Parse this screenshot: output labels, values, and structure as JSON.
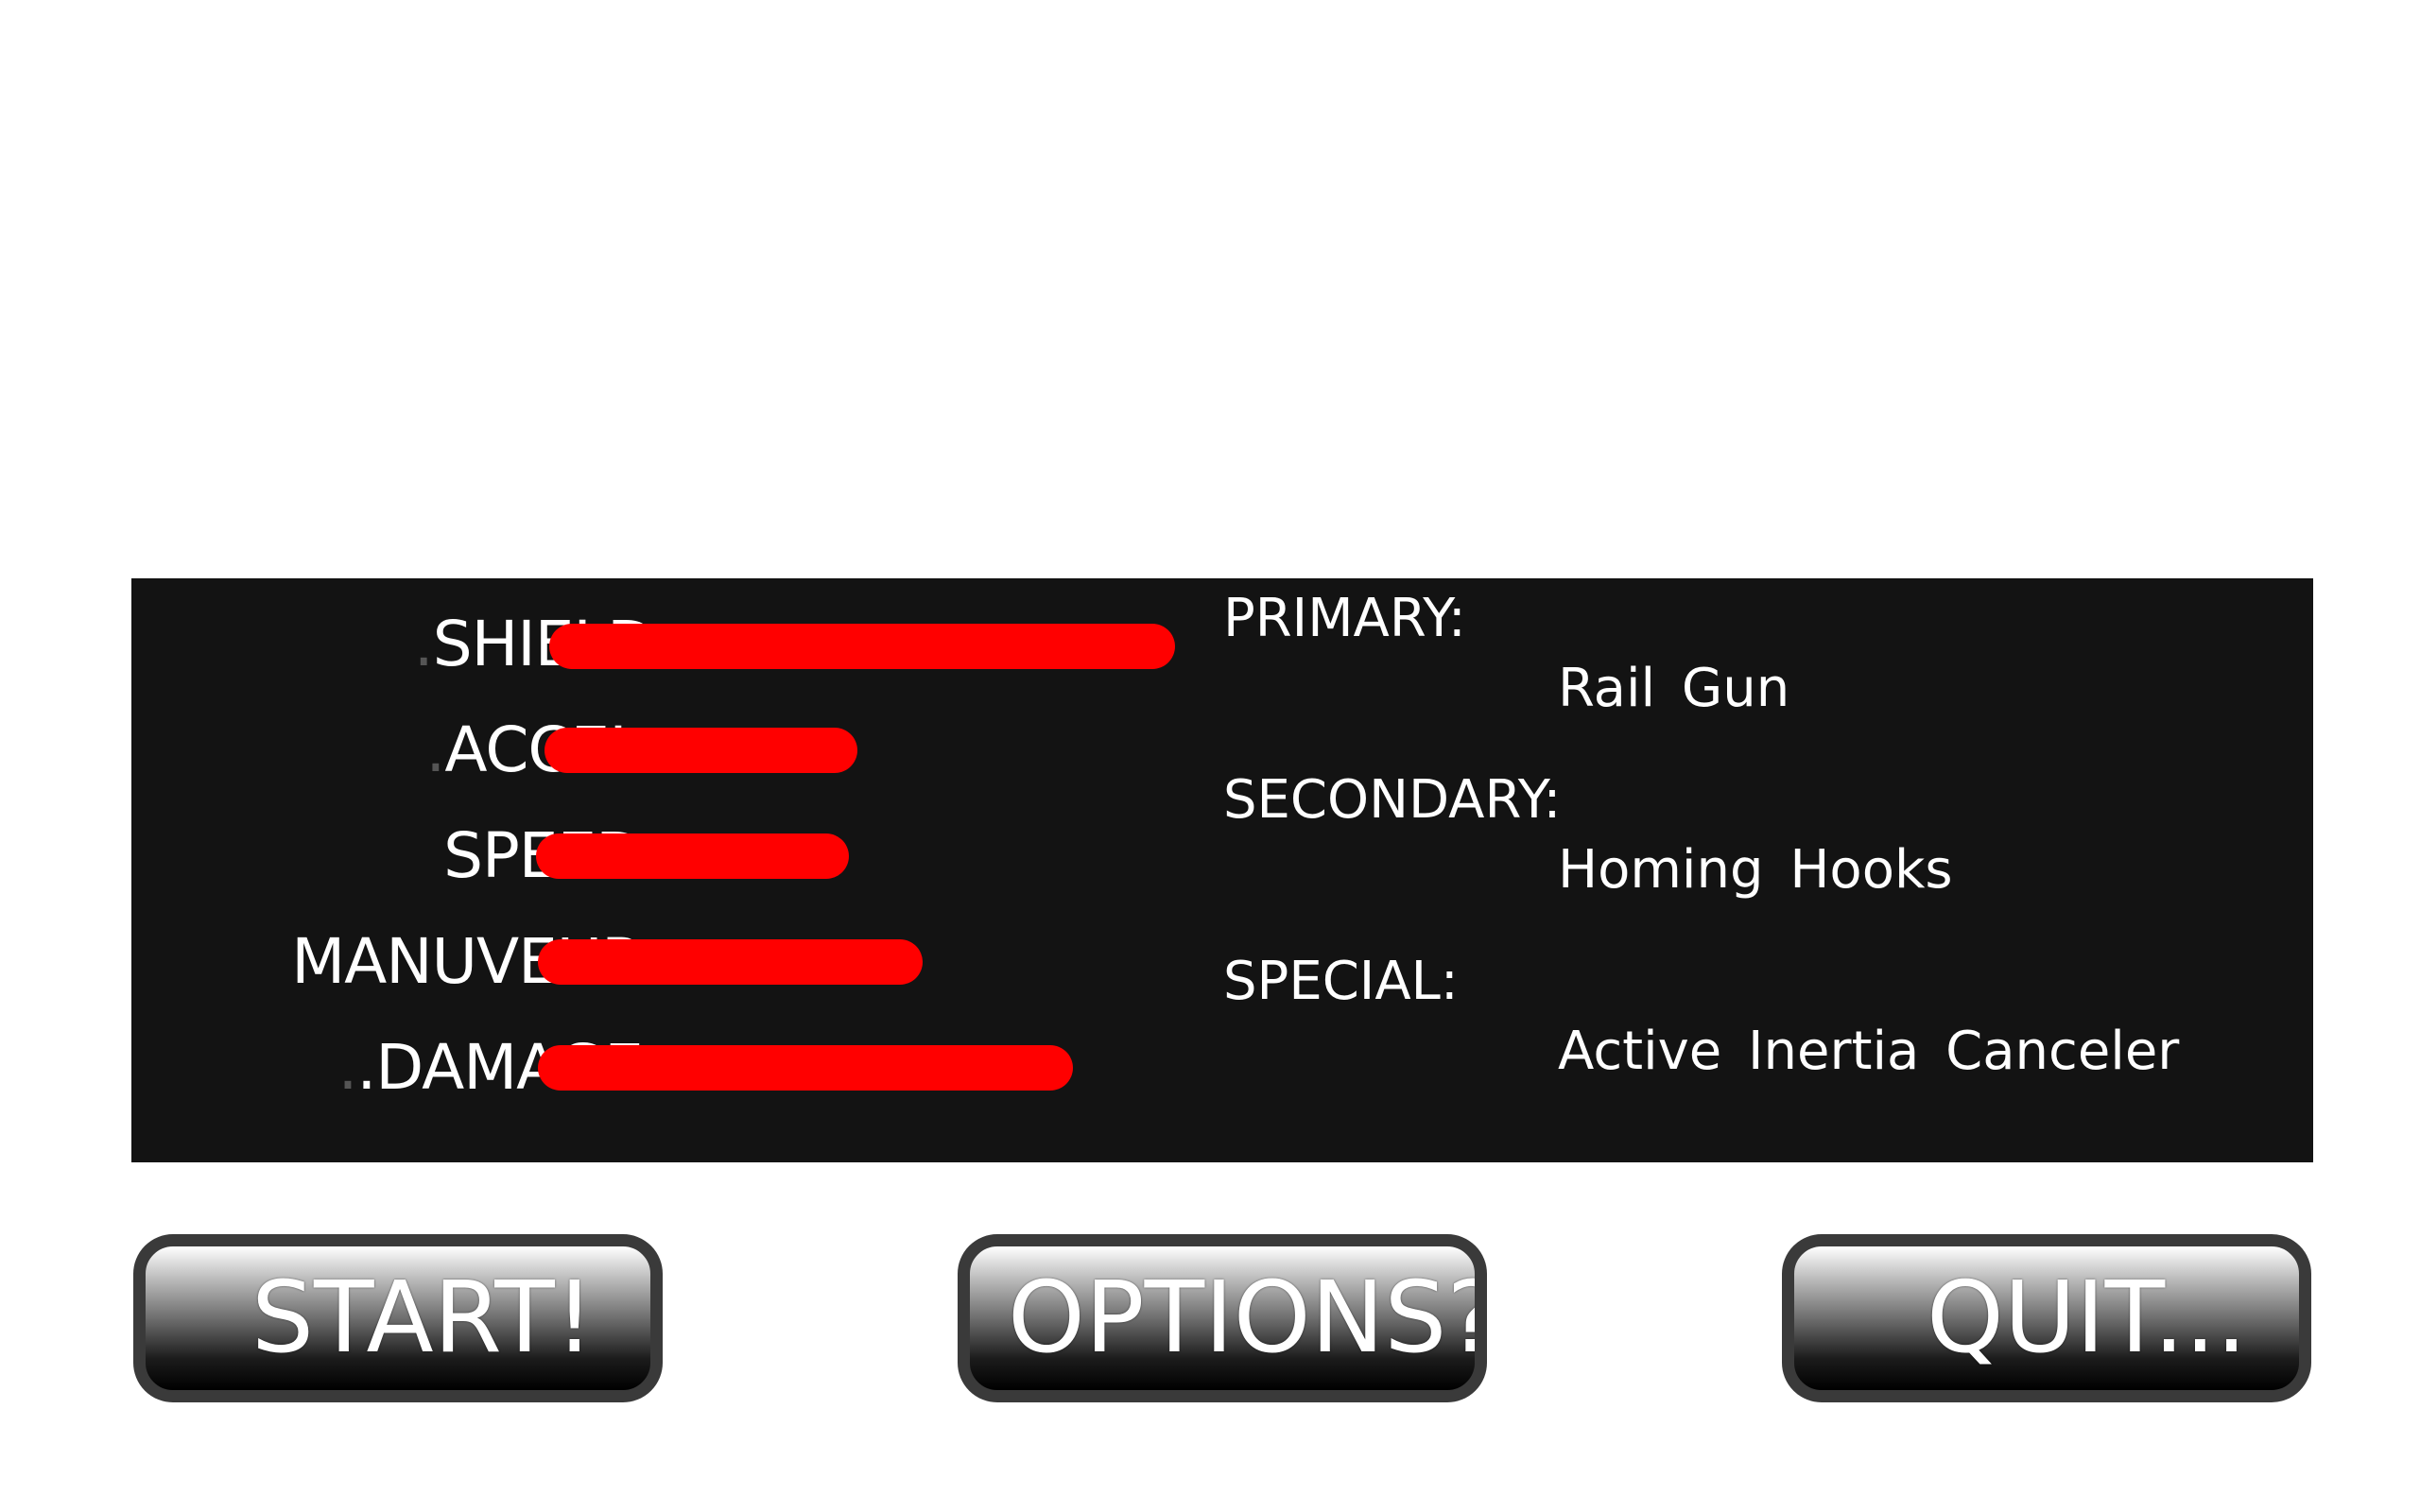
{
  "stats": [
    {
      "label": "SHIELD",
      "prefix": ".",
      "value": 1.0
    },
    {
      "label": "ACCEL",
      "prefix": ".",
      "value": 0.5
    },
    {
      "label": "SPEED",
      "prefix": "",
      "value": 0.5
    },
    {
      "label": "MANUVEUR",
      "prefix": "",
      "value": 0.615
    },
    {
      "label": ".DAMAGE",
      "prefix": ".",
      "value": 0.855
    }
  ],
  "weapons": {
    "primary_heading": "PRIMARY:",
    "primary_value": "Rail Gun",
    "secondary_heading": "SECONDARY:",
    "secondary_value": "Homing Hooks",
    "special_heading": "SPECIAL:",
    "special_value": "Active Inertia Canceler"
  },
  "buttons": {
    "start": "START!",
    "options": "OPTIONS?",
    "quit": "QUIT..."
  },
  "colors": {
    "bar": "#ff0000",
    "panel": "#131313",
    "button_border": "#3a3a3a"
  }
}
